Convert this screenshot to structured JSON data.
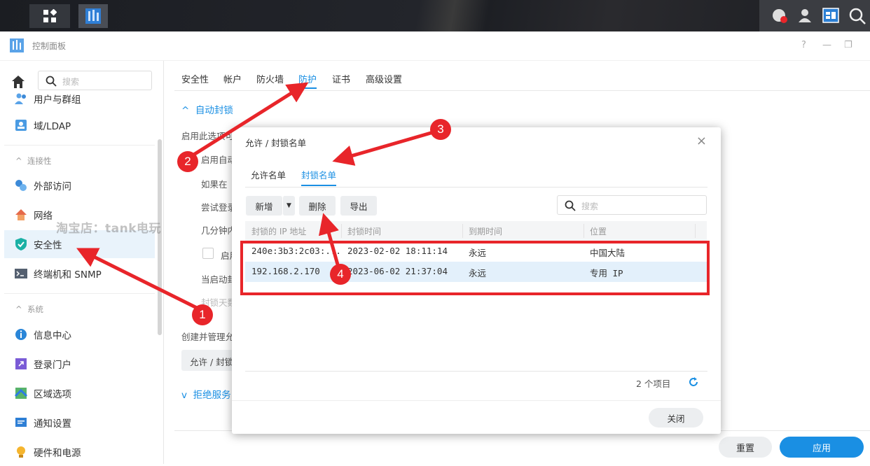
{
  "window": {
    "title": "控制面板",
    "help": "?",
    "minimize": "—",
    "restore": "❐"
  },
  "sidebar": {
    "search_placeholder": "搜索",
    "items": [
      {
        "label": "用户与群组"
      },
      {
        "label": "域/LDAP"
      },
      {
        "label": "外部访问"
      },
      {
        "label": "网络"
      },
      {
        "label": "安全性",
        "active": true
      },
      {
        "label": "终端机和 SNMP"
      },
      {
        "label": "信息中心"
      },
      {
        "label": "登录门户"
      },
      {
        "label": "区域选项"
      },
      {
        "label": "通知设置"
      },
      {
        "label": "硬件和电源"
      }
    ],
    "groups": {
      "connectivity": "连接性",
      "system": "系统"
    }
  },
  "main": {
    "tabs": [
      "安全性",
      "帐户",
      "防火墙",
      "防护",
      "证书",
      "高级设置"
    ],
    "active_tab": "防护",
    "section_auto_block": "自动封锁",
    "line1": "启用此选项可",
    "line2": "启用自动",
    "line3": "如果在",
    "line4": "尝试登录",
    "line5": "几分钟内",
    "line6": "启用",
    "line7": "当启动封",
    "line8": "封锁天数",
    "line9": "创建并管理允",
    "allow_list_btn": "允许 / 封锁",
    "section_dos": "拒绝服务",
    "reset_btn": "重置",
    "apply_btn": "应用"
  },
  "modal": {
    "title": "允许 / 封锁名单",
    "close_symbol": "×",
    "tabs": [
      "允许名单",
      "封锁名单"
    ],
    "active_tab": "封锁名单",
    "toolbar": {
      "add": "新增",
      "delete": "删除",
      "export": "导出"
    },
    "search_placeholder": "搜索",
    "columns": [
      "封锁的 IP 地址",
      "封锁时间",
      "到期时间",
      "位置"
    ],
    "rows": [
      {
        "ip": "240e:3b3:2c03:...",
        "time": "2023-02-02 18:11:14",
        "expire": "永远",
        "location": "中国大陆"
      },
      {
        "ip": "192.168.2.170",
        "time": "2023-06-02 21:37:04",
        "expire": "永远",
        "location": "专用 IP"
      }
    ],
    "count": "2 个项目",
    "close_btn": "关闭"
  },
  "annotations": {
    "watermark": "淘宝店：tank电玩",
    "badges": [
      "1",
      "2",
      "3",
      "4"
    ]
  },
  "colors": {
    "accent": "#1a8fe3",
    "annotation": "#e8252a"
  }
}
